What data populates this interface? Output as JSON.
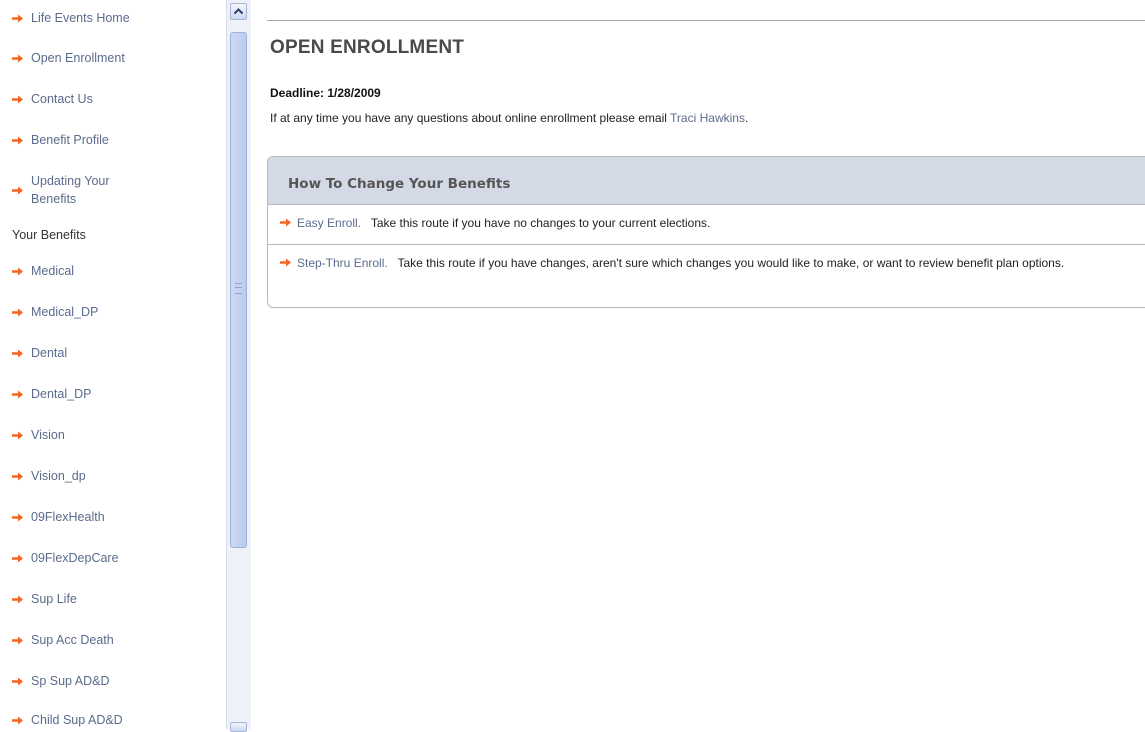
{
  "sidebar": {
    "items_top": [
      {
        "label": "Life Events Home"
      },
      {
        "label": "Open Enrollment"
      },
      {
        "label": "Contact Us"
      },
      {
        "label": "Benefit Profile"
      },
      {
        "label": "Updating Your Benefits"
      }
    ],
    "section_label": "Your Benefits",
    "benefits": [
      {
        "label": "Medical"
      },
      {
        "label": "Medical_DP"
      },
      {
        "label": "Dental"
      },
      {
        "label": "Dental_DP"
      },
      {
        "label": "Vision"
      },
      {
        "label": "Vision_dp"
      },
      {
        "label": "09FlexHealth"
      },
      {
        "label": "09FlexDepCare"
      },
      {
        "label": "Sup Life"
      },
      {
        "label": "Sup Acc Death"
      },
      {
        "label": "Sp Sup AD&D"
      },
      {
        "label": "Child Sup AD&D"
      }
    ]
  },
  "main": {
    "title": "OPEN ENROLLMENT",
    "deadline": "Deadline: 1/28/2009",
    "intro_text": "If at any time you have any questions about online enrollment please email",
    "contact_name": "Traci Hawkins",
    "intro_end": ".",
    "panel": {
      "title": "How To Change Your Benefits",
      "options": [
        {
          "link": "Easy Enroll.",
          "text": "Take this route if you have no changes to your current elections."
        },
        {
          "link": "Step-Thru Enroll.",
          "text": "Take this route if you have changes, aren't sure which changes you would like to make, or want to review benefit plan options."
        }
      ]
    }
  },
  "icons": {
    "bullet": "orange-arrow-icon",
    "scroll_up": "chevron-up-icon"
  },
  "colors": {
    "accent_arrow": "#f26522",
    "link": "#5b6b8c",
    "panel_header": "#d4d9e6"
  }
}
